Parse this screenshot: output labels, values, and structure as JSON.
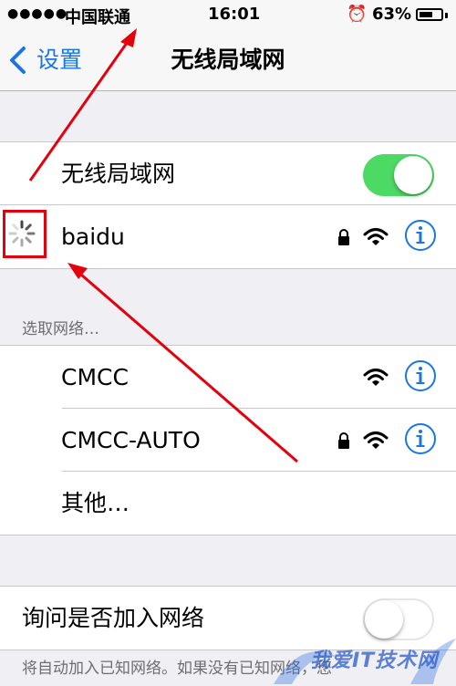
{
  "status_bar": {
    "signal": "●●●●●",
    "carrier": "中国联通",
    "time": "16:01",
    "battery_percent_label": "63%",
    "battery_level": 0.63,
    "alarm_icon": "alarm-clock-icon"
  },
  "nav": {
    "back_label": "设置",
    "title": "无线局域网"
  },
  "wifi_toggle": {
    "label": "无线局域网",
    "on": true
  },
  "current_network": {
    "name": "baidu",
    "secured": true,
    "state": "connecting"
  },
  "choose_network_header": "选取网络…",
  "networks": [
    {
      "name": "CMCC",
      "secured": false
    },
    {
      "name": "CMCC-AUTO",
      "secured": true
    }
  ],
  "other_label": "其他…",
  "ask_to_join": {
    "label": "询问是否加入网络",
    "on": false
  },
  "footer": "将自动加入已知网络。如果没有已知网络，您",
  "watermark": "我爱IT技术网",
  "colors": {
    "accent": "#1a76e0",
    "toggle_on": "#4cd964",
    "annotation": "#e5000d"
  }
}
